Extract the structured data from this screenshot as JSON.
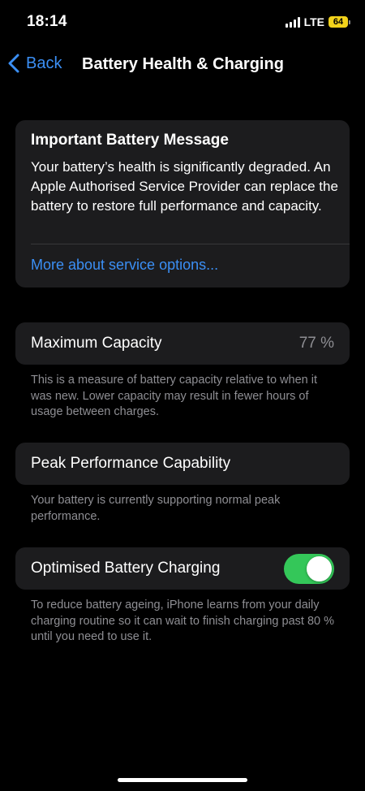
{
  "status_bar": {
    "time": "18:14",
    "network": "LTE",
    "battery_level": "64"
  },
  "nav": {
    "back_label": "Back",
    "title": "Battery Health & Charging"
  },
  "message": {
    "title": "Important Battery Message",
    "body": "Your battery’s health is significantly degraded. An Apple Authorised Service Provider can replace the battery to restore full performance and capacity.",
    "link": "More about service options..."
  },
  "capacity": {
    "label": "Maximum Capacity",
    "value": "77 %",
    "note": "This is a measure of battery capacity relative to when it was new. Lower capacity may result in fewer hours of usage between charges."
  },
  "peak": {
    "label": "Peak Performance Capability",
    "note": "Your battery is currently supporting normal peak performance."
  },
  "charging": {
    "label": "Optimised Battery Charging",
    "enabled": true,
    "note": "To reduce battery ageing, iPhone learns from your daily charging routine so it can wait to finish charging past 80 % until you need to use it."
  },
  "colors": {
    "accent": "#3b8ff5",
    "toggle_on": "#34c759",
    "card_background": "#1c1c1e",
    "secondary_text": "#8e8e93",
    "battery_fill": "#f2d21b"
  },
  "icons": {
    "back": "chevron-left-icon",
    "signal": "cellular-signal-icon",
    "battery": "battery-icon"
  }
}
